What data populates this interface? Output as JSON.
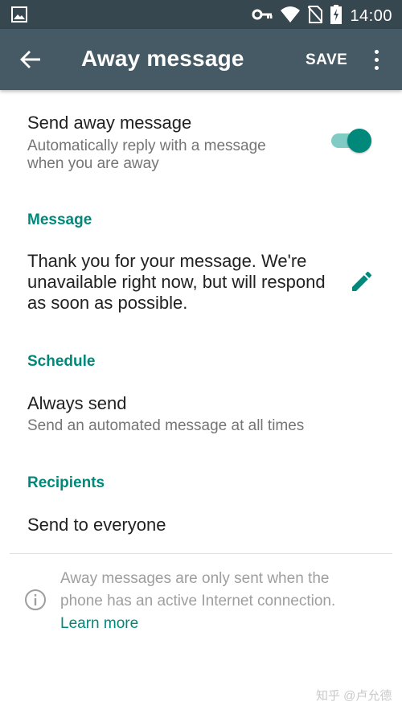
{
  "status_bar": {
    "time": "14:00",
    "icons": [
      "image-icon",
      "key-icon",
      "wifi-icon",
      "no-sim-icon",
      "battery-charging-icon"
    ]
  },
  "app_bar": {
    "title": "Away message",
    "save_label": "SAVE",
    "icons": [
      "back-arrow-icon",
      "more-vert-icon"
    ]
  },
  "send_away": {
    "title": "Send away message",
    "line1": "Automatically reply with a message",
    "line2": "when you are away",
    "enabled": true
  },
  "message": {
    "header": "Message",
    "line1": "Thank you for your message. We're",
    "line2": "unavailable right now, but will respond",
    "line3": "as soon as possible.",
    "icon": "edit-icon"
  },
  "schedule": {
    "header": "Schedule",
    "title": "Always send",
    "subtitle": "Send an automated message at all times"
  },
  "recipients": {
    "header": "Recipients",
    "title": "Send to everyone"
  },
  "info": {
    "line1": "Away messages are only sent when the",
    "line2": "phone has an active Internet connection.",
    "link": "Learn more",
    "icon": "info-icon"
  },
  "watermark": "知乎 @卢允德",
  "colors": {
    "status_bar": "#37474f",
    "app_bar": "#455a64",
    "accent": "#00897b",
    "toggle_track": "#80cbc4"
  }
}
